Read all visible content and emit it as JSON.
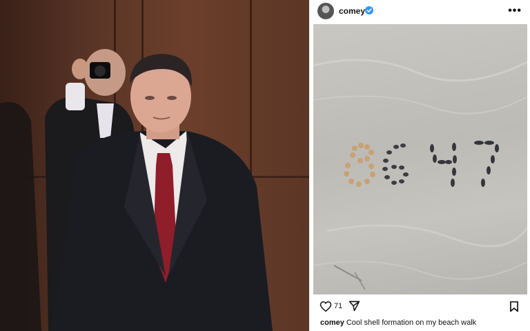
{
  "post": {
    "username": "comey",
    "verified": true,
    "more_icon": "more-horizontal-icon",
    "image_text": "86 47",
    "like_count": "71",
    "caption_user": "comey",
    "caption_text": "Cool shell formation on my beach walk"
  },
  "icons": [
    "heart-icon",
    "send-icon",
    "bookmark-icon",
    "verified-badge-icon"
  ],
  "colors": {
    "verified_blue": "#3897f0",
    "tie_red": "#8f1d2a",
    "wall_brown": "#5a3526"
  }
}
